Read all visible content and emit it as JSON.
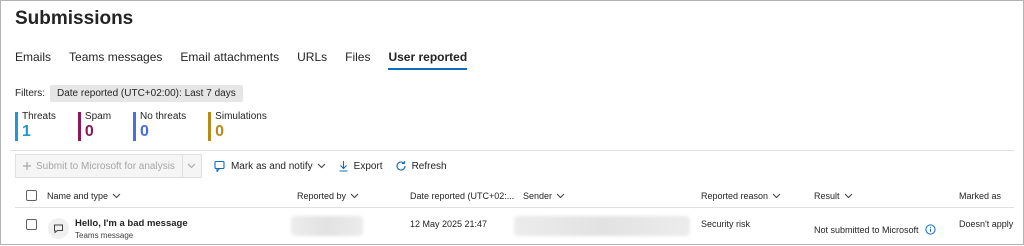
{
  "page": {
    "title": "Submissions"
  },
  "tabs": [
    {
      "label": "Emails"
    },
    {
      "label": "Teams messages"
    },
    {
      "label": "Email attachments"
    },
    {
      "label": "URLs"
    },
    {
      "label": "Files"
    },
    {
      "label": "User reported",
      "active": true
    }
  ],
  "filters": {
    "label": "Filters:",
    "pill_key": "Date reported (UTC+02:00): ",
    "pill_value": "Last 7 days"
  },
  "stats": [
    {
      "label": "Threats",
      "count": "1",
      "color": "#1b9bd1"
    },
    {
      "label": "Spam",
      "count": "0",
      "color": "#8a1a55"
    },
    {
      "label": "No threats",
      "count": "0",
      "color": "#4a6fdc"
    },
    {
      "label": "Simulations",
      "count": "0",
      "color": "#b88a17"
    }
  ],
  "toolbar": {
    "submit_label": "Submit to Microsoft for analysis",
    "mark_label": "Mark as and notify",
    "export_label": "Export",
    "refresh_label": "Refresh"
  },
  "table": {
    "columns": {
      "name": "Name and type",
      "reported_by": "Reported by",
      "date": "Date reported (UTC+02:...",
      "sender": "Sender",
      "reason": "Reported reason",
      "result": "Result",
      "marked": "Marked as"
    },
    "rows": [
      {
        "subject": "Hello, I'm a bad message",
        "type": "Teams message",
        "date": "12 May 2025 21:47",
        "reason": "Security risk",
        "result": "Not submitted to Microsoft",
        "marked": "Doesn't apply"
      }
    ]
  },
  "colors": {
    "accent": "#0f6cbd",
    "disabled_text": "#a6a6a6"
  },
  "icons": {
    "plus": "plus-icon",
    "chevron": "chevron-down-icon",
    "mark": "flag-note-icon",
    "export": "download-icon",
    "refresh": "refresh-icon",
    "info": "info-icon",
    "message": "chat-message-icon"
  }
}
